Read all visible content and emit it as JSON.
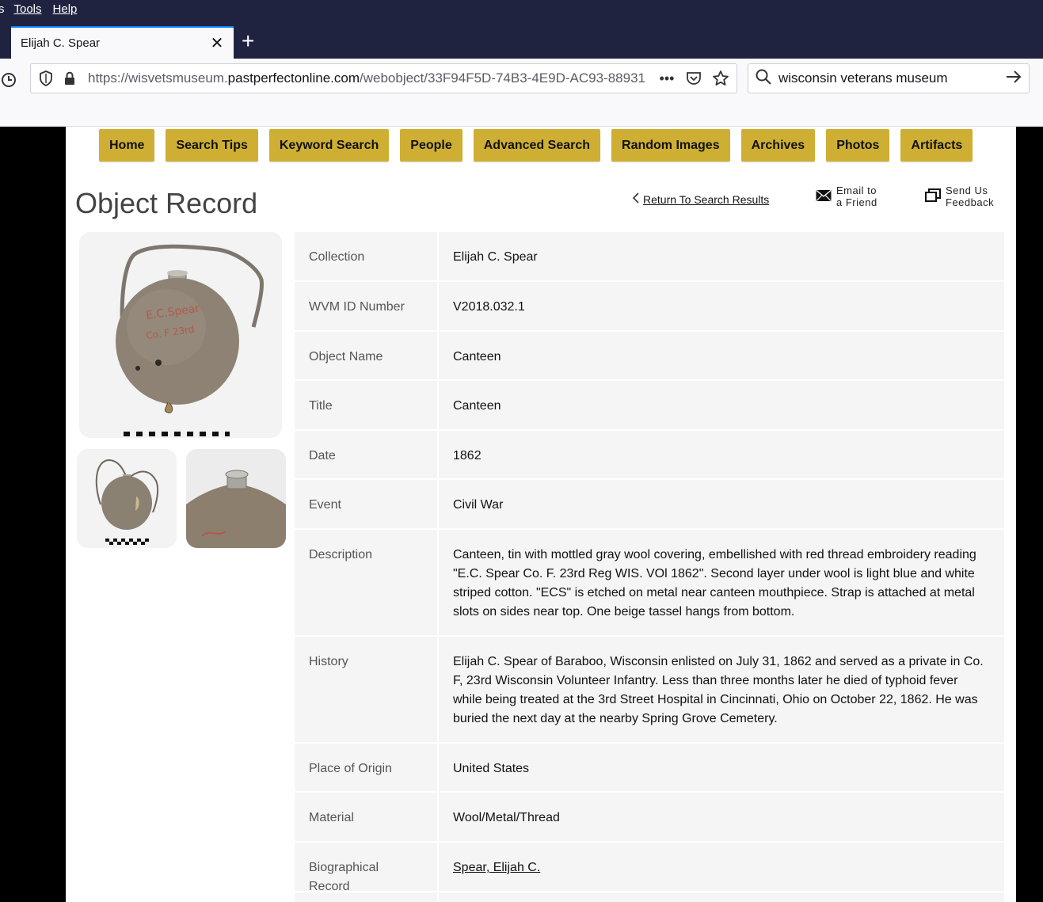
{
  "menu": {
    "first": "s",
    "tools": "Tools",
    "help": "Help"
  },
  "tab": {
    "title": "Elijah C. Spear"
  },
  "urlbar": {
    "prefix": "https://wisvetsmuseum.",
    "domain": "pastperfectonline.com",
    "path": "/webobject/33F94F5D-74B3-4E9D-AC93-88931"
  },
  "searchbar": {
    "value": "wisconsin veterans museum"
  },
  "nav": [
    "Home",
    "Search Tips",
    "Keyword Search",
    "People",
    "Advanced Search",
    "Random Images",
    "Archives",
    "Photos",
    "Artifacts"
  ],
  "page": {
    "title": "Object Record",
    "return_link": "Return To Search Results",
    "email_label": "Email to\na Friend",
    "feedback_label": "Send Us\nFeedback"
  },
  "record": [
    {
      "label": "Collection",
      "value": "Elijah C. Spear"
    },
    {
      "label": "WVM ID Number",
      "value": "V2018.032.1"
    },
    {
      "label": "Object Name",
      "value": "Canteen"
    },
    {
      "label": "Title",
      "value": "Canteen"
    },
    {
      "label": "Date",
      "value": "1862"
    },
    {
      "label": "Event",
      "value": "Civil War"
    },
    {
      "label": "Description",
      "value": "Canteen, tin with mottled gray wool covering, embellished with red thread embroidery reading \"E.C. Spear Co. F. 23rd Reg WIS. VOl 1862\". Second layer under wool is light blue and white striped cotton. \"ECS\" is etched on metal near canteen mouthpiece. Strap is attached at metal slots on sides near top. One beige tassel hangs from bottom."
    },
    {
      "label": "History",
      "value": "Elijah C. Spear of Baraboo, Wisconsin enlisted on July 31, 1862 and served as a private in Co. F, 23rd Wisconsin Volunteer Infantry. Less than three months later he died of typhoid fever while being treated at the 3rd Street Hospital in Cincinnati, Ohio on October 22, 1862. He was buried the next day at the nearby Spring Grove Cemetery."
    },
    {
      "label": "Place of Origin",
      "value": "United States"
    },
    {
      "label": "Material",
      "value": "Wool/Metal/Thread"
    },
    {
      "label": "Biographical Record",
      "value": "Spear, Elijah C."
    }
  ],
  "colors": {
    "nav_button": "#cfaf33",
    "chrome": "#202340",
    "accent": "#0a84ff"
  }
}
